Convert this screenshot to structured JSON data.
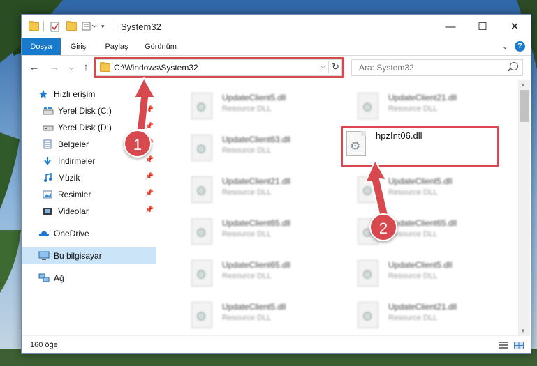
{
  "window": {
    "title": "System32"
  },
  "window_controls": {
    "minimize": "—",
    "maximize": "☐",
    "close": "✕"
  },
  "ribbon": {
    "tabs": [
      "Dosya",
      "Giriş",
      "Paylaş",
      "Görünüm"
    ],
    "help": "?"
  },
  "address": {
    "path": "C:\\Windows\\System32",
    "dropdown": "⌵",
    "refresh": "↻"
  },
  "search": {
    "placeholder": "Ara: System32"
  },
  "sidebar": {
    "items": [
      {
        "label": "Hızlı erişim",
        "icon": "star-icon",
        "pinned": false
      },
      {
        "label": "Yerel Disk (C:)",
        "icon": "drive-icon",
        "pinned": true
      },
      {
        "label": "Yerel Disk (D:)",
        "icon": "drive-icon",
        "pinned": true
      },
      {
        "label": "Belgeler",
        "icon": "documents-icon",
        "pinned": true
      },
      {
        "label": "İndirmeler",
        "icon": "download-icon",
        "pinned": true
      },
      {
        "label": "Müzik",
        "icon": "music-icon",
        "pinned": true
      },
      {
        "label": "Resimler",
        "icon": "pictures-icon",
        "pinned": true
      },
      {
        "label": "Videolar",
        "icon": "videos-icon",
        "pinned": true
      },
      {
        "label": "OneDrive",
        "icon": "cloud-icon",
        "pinned": false
      },
      {
        "label": "Bu bilgisayar",
        "icon": "computer-icon",
        "pinned": false,
        "selected": true
      },
      {
        "label": "Ağ",
        "icon": "network-icon",
        "pinned": false
      }
    ]
  },
  "files": {
    "left": [
      {
        "name": "UpdateClient5.dll",
        "type": "Resource DLL"
      },
      {
        "name": "UpdateClient63.dll",
        "type": "Resource DLL"
      },
      {
        "name": "UpdateClient21.dll",
        "type": "Resource DLL"
      },
      {
        "name": "UpdateClient65.dll",
        "type": "Resource DLL"
      },
      {
        "name": "UpdateClient65.dll",
        "type": "Resource DLL"
      },
      {
        "name": "UpdateClient5.dll",
        "type": "Resource DLL"
      }
    ],
    "right": [
      {
        "name": "UpdateClient21.dll",
        "type": "Resource DLL"
      },
      {
        "name": "UpdateClient5.dll",
        "type": "Resource DLL"
      },
      {
        "name": "UpdateClient65.dll",
        "type": "Resource DLL"
      },
      {
        "name": "UpdateClient5.dll",
        "type": "Resource DLL"
      },
      {
        "name": "UpdateClient21.dll",
        "type": "Resource DLL"
      }
    ],
    "highlighted": {
      "name": "hpzInt06.dll"
    }
  },
  "status": {
    "count": "160 öğe"
  },
  "annotations": {
    "badge1": "1",
    "badge2": "2"
  },
  "colors": {
    "accent": "#1979ca",
    "annotation_red": "#d8494f",
    "selected_bg": "#cce4f7"
  }
}
